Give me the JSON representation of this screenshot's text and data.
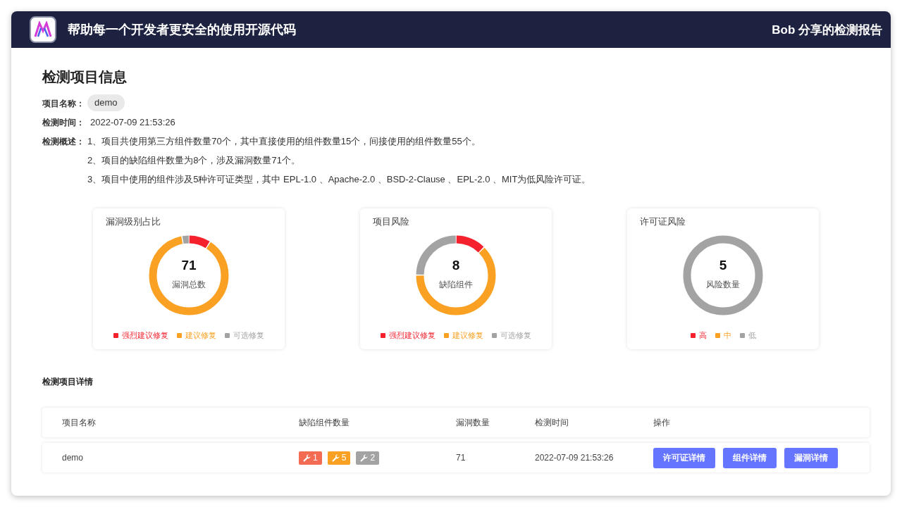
{
  "header": {
    "title": "帮助每一个开发者更安全的使用开源代码",
    "share_label": "Bob 分享的检测报告"
  },
  "project_info": {
    "heading": "检测项目信息",
    "fields": [
      {
        "kind": "tag",
        "label": "项目名称：",
        "value": "demo"
      },
      {
        "kind": "text",
        "label": "检测时间：",
        "value": "2022-07-09 21:53:26"
      },
      {
        "kind": "list",
        "label": "检测概述：",
        "lines": [
          "1、项目共使用第三方组件数量70个，其中直接使用的组件数量15个，间接使用的组件数量55个。",
          "2、项目的缺陷组件数量为8个，涉及漏洞数量71个。",
          "3、项目中使用的组件涉及5种许可证类型，其中 EPL-1.0 、Apache-2.0 、BSD-2-Clause 、EPL-2.0 、MIT为低风险许可证。"
        ]
      }
    ]
  },
  "charts": [
    {
      "title": "漏洞级别占比",
      "total": "71",
      "caption": "漏洞总数",
      "legend": [
        {
          "label": "强烈建议修复",
          "color": "#f5222d"
        },
        {
          "label": "建议修复",
          "color": "#faa123"
        },
        {
          "label": "可选修复",
          "color": "#a3a3a3"
        }
      ]
    },
    {
      "title": "项目风险",
      "total": "8",
      "caption": "缺陷组件",
      "legend": [
        {
          "label": "强烈建议修复",
          "color": "#f5222d"
        },
        {
          "label": "建议修复",
          "color": "#faa123"
        },
        {
          "label": "可选修复",
          "color": "#a3a3a3"
        }
      ]
    },
    {
      "title": "许可证风险",
      "total": "5",
      "caption": "风险数量",
      "legend": [
        {
          "label": "高",
          "color": "#f5222d"
        },
        {
          "label": "中",
          "color": "#faa123"
        },
        {
          "label": "低",
          "color": "#a3a3a3"
        }
      ]
    }
  ],
  "details": {
    "heading": "检测项目详情",
    "columns": [
      "项目名称",
      "缺陷组件数量",
      "漏洞数量",
      "检测时间",
      "操作"
    ],
    "rows": [
      {
        "project_name": "demo",
        "defect_badges": [
          {
            "count": "1",
            "color": "#f26b52"
          },
          {
            "count": "5",
            "color": "#faa123"
          },
          {
            "count": "2",
            "color": "#a3a3a3"
          }
        ],
        "vulnerabilities": "71",
        "time": "2022-07-09 21:53:26",
        "actions": [
          "许可证详情",
          "组件详情",
          "漏洞详情"
        ]
      }
    ]
  }
}
